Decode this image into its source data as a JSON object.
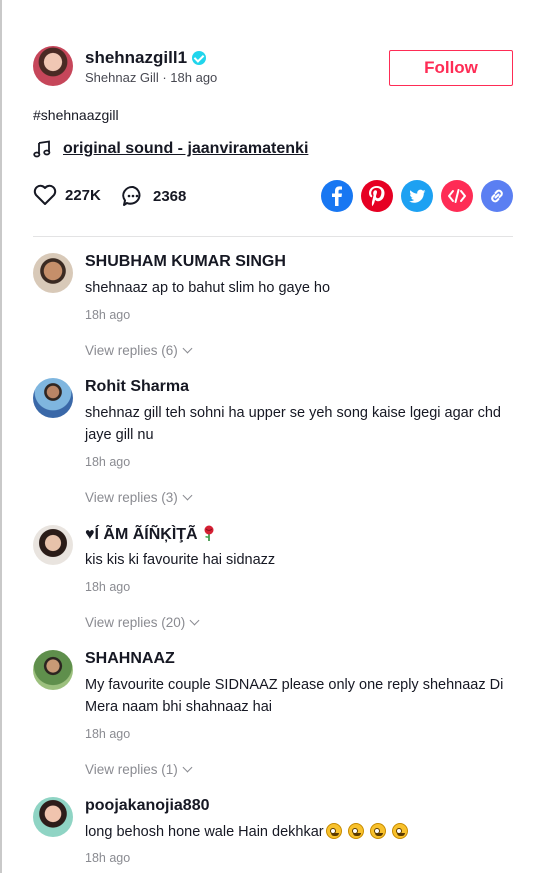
{
  "post": {
    "author_handle": "shehnazgill1",
    "author_name": "Shehnaz Gill",
    "separator": " · ",
    "posted_ago": "18h ago",
    "follow_label": "Follow",
    "hashtag": "#shehnaazgill",
    "sound": "original sound - jaanviramatenki",
    "likes": "227K",
    "comments_count": "2368"
  },
  "share": [
    "facebook-icon",
    "pinterest-icon",
    "twitter-icon",
    "embed-icon",
    "link-icon"
  ],
  "colors": {
    "accent": "#fe2c55",
    "verified": "#20d5ec",
    "facebook": "#1877f2",
    "pinterest": "#e60023",
    "twitter": "#1da1f2",
    "embed": "#fe2c55",
    "link": "#5b7ff2",
    "muted": "#8a8b91"
  },
  "comments": [
    {
      "name": "SHUBHAM KUMAR SINGH",
      "text": "shehnaaz ap to bahut slim ho gaye ho",
      "time": "18h ago",
      "replies": "View replies (6)"
    },
    {
      "name": "Rohit Sharma",
      "text": "shehnaz gill teh sohni ha upper se yeh song kaise lgegi agar chd jaye gill nu",
      "time": "18h ago",
      "replies": "View replies (3)"
    },
    {
      "name_prefix": "♥",
      "name": "Í ÃM ÃÍÑĶÌŢÃ",
      "text": "kis kis ki favourite hai sidnazz",
      "time": "18h ago",
      "replies": "View replies (20)"
    },
    {
      "name": "SHAHNAAZ",
      "text": "My favourite couple SIDNAAZ please only one reply shehnaaz Di Mera naam bhi shahnaaz hai",
      "time": "18h ago",
      "replies": "View replies (1)"
    },
    {
      "name": "poojakanojia880",
      "text": "long behosh hone wale Hain dekhkar",
      "time": "18h ago"
    }
  ]
}
